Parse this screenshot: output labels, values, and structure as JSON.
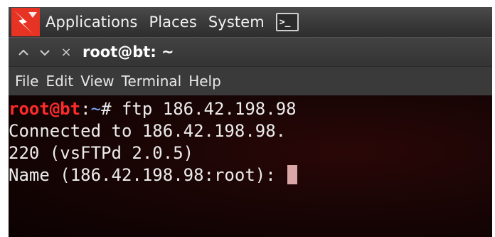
{
  "panel": {
    "menus": [
      "Applications",
      "Places",
      "System"
    ],
    "launcher_glyph": ">_"
  },
  "window": {
    "up_label": "^",
    "down_label": "v",
    "close_label": "×",
    "title": "root@bt: ~"
  },
  "menubar": {
    "items": [
      "File",
      "Edit",
      "View",
      "Terminal",
      "Help"
    ]
  },
  "terminal": {
    "prompt_user": "root@bt",
    "prompt_sep": ":",
    "prompt_path": "~",
    "prompt_symbol": "#",
    "command": " ftp 186.42.198.98",
    "output": [
      "Connected to 186.42.198.98.",
      "220 (vsFTPd 2.0.5)"
    ],
    "input_prompt": "Name (186.42.198.98:root): "
  },
  "colors": {
    "prompt_user": "#ff2b2b",
    "prompt_path": "#7aa6ff",
    "cursor": "#d9a7a7",
    "background": "#1a0505"
  },
  "icons": {
    "logo": "backtrack-dragon-icon",
    "launcher": "terminal-icon"
  }
}
